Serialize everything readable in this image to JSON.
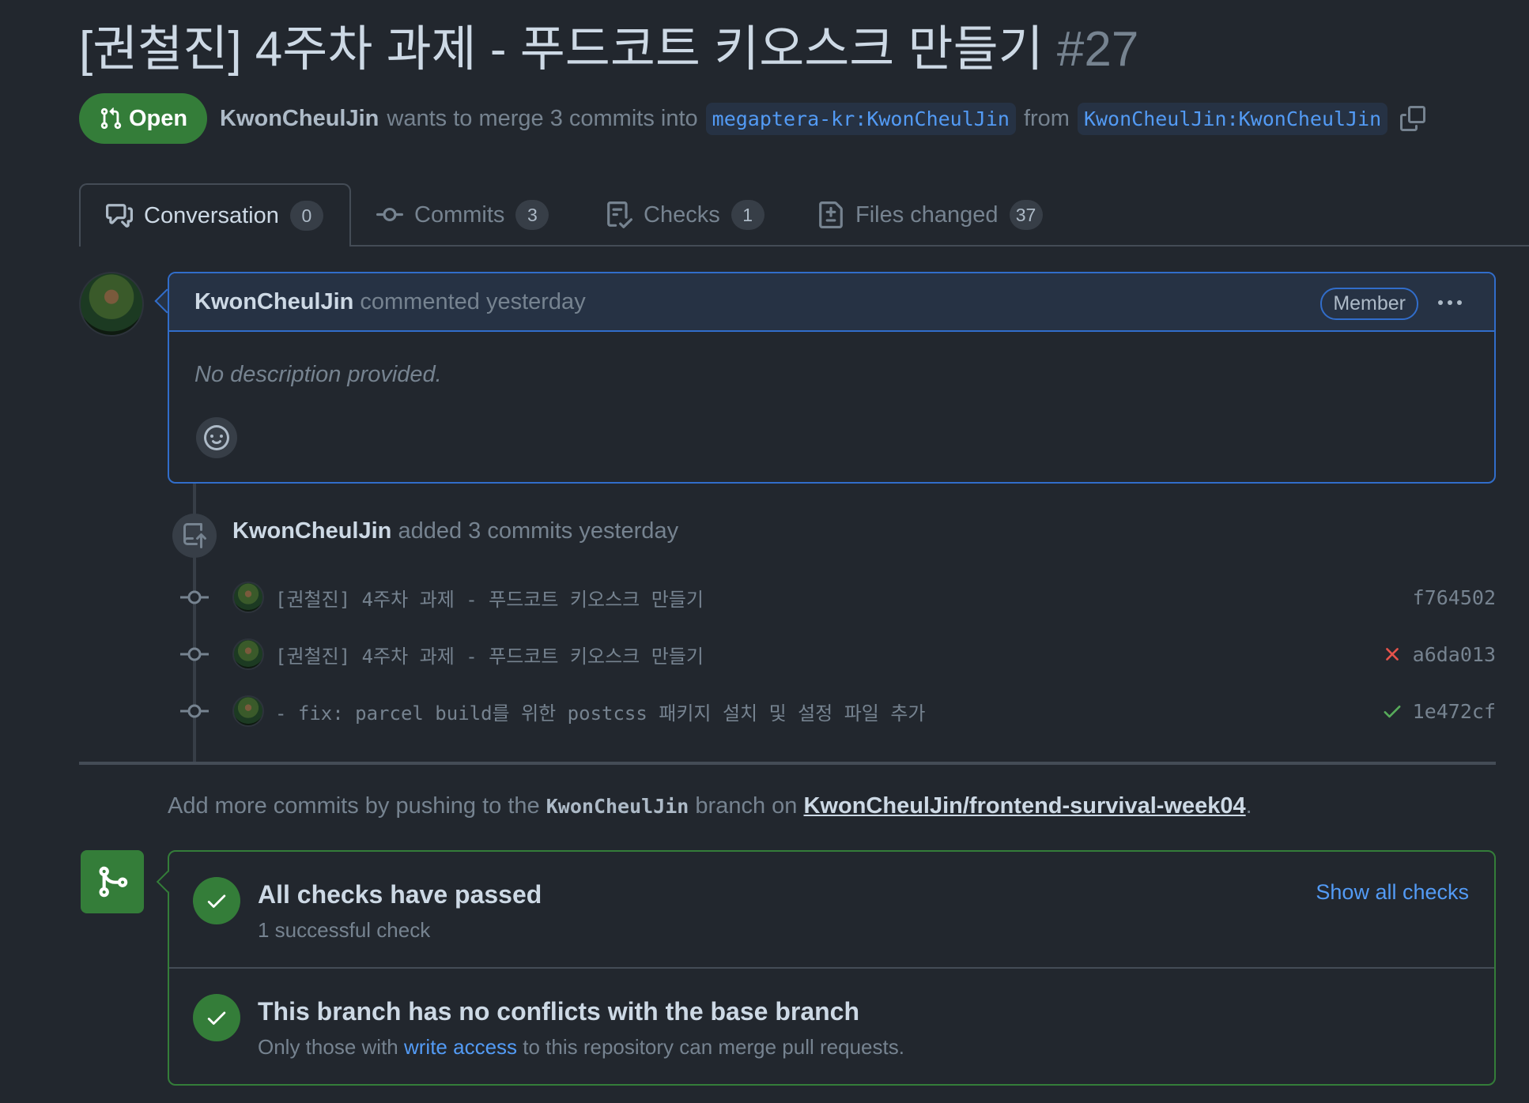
{
  "pr": {
    "title": "[권철진] 4주차 과제 - 푸드코트 키오스크 만들기",
    "number": "#27",
    "state": "Open",
    "author": "KwonCheulJin",
    "merge_text": "wants to merge 3 commits into",
    "base_branch": "megaptera-kr:KwonCheulJin",
    "from_text": "from",
    "head_branch": "KwonCheulJin:KwonCheulJin"
  },
  "tabs": [
    {
      "label": "Conversation",
      "count": "0"
    },
    {
      "label": "Commits",
      "count": "3"
    },
    {
      "label": "Checks",
      "count": "1"
    },
    {
      "label": "Files changed",
      "count": "37"
    }
  ],
  "comment": {
    "author": "KwonCheulJin",
    "meta": "commented yesterday",
    "badge": "Member",
    "body": "No description provided."
  },
  "commit_event": {
    "author": "KwonCheulJin",
    "text": "added 3 commits yesterday"
  },
  "commits": [
    {
      "message": "[권철진] 4주차 과제 - 푸드코트 키오스크 만들기",
      "status": "",
      "sha": "f764502"
    },
    {
      "message": "[권철진] 4주차 과제 - 푸드코트 키오스크 만들기",
      "status": "failed",
      "sha": "a6da013"
    },
    {
      "message": "- fix: parcel build를 위한 postcss 패키지 설치 및 설정 파일 추가",
      "status": "passed",
      "sha": "1e472cf"
    }
  ],
  "push_note": {
    "prefix": "Add more commits by pushing to the",
    "branch": "KwonCheulJin",
    "middle": "branch on",
    "repo_link": "KwonCheulJin/frontend-survival-week04",
    "suffix": "."
  },
  "merge": {
    "checks_title": "All checks have passed",
    "checks_sub": "1 successful check",
    "show_all": "Show all checks",
    "conflicts_title": "This branch has no conflicts with the base branch",
    "conflicts_sub_prefix": "Only those with",
    "conflicts_link": "write access",
    "conflicts_sub_suffix": "to this repository can merge pull requests."
  },
  "colors": {
    "background": "#22272e",
    "open_green": "#347d39",
    "link_blue": "#539bf5",
    "fail_red": "#e5534b",
    "pass_green": "#57ab5a"
  }
}
